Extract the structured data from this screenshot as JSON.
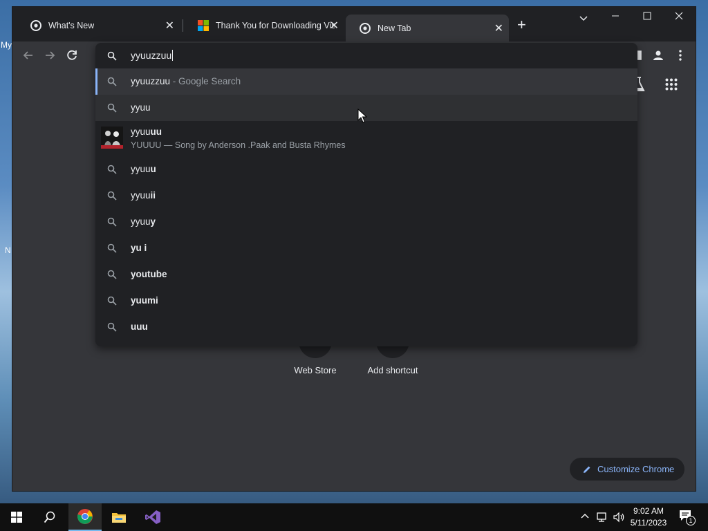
{
  "desktop": {
    "label_my": "My",
    "label_n": "N"
  },
  "tabs": [
    {
      "title": "What's New",
      "favicon": "chrome-icon",
      "active": false
    },
    {
      "title": "Thank You for Downloading Visu",
      "favicon": "microsoft-icon",
      "active": false
    },
    {
      "title": "New Tab",
      "favicon": "chrome-icon",
      "active": true
    }
  ],
  "omnibox": {
    "value": "yyuuzzuu",
    "suggestions": [
      {
        "bold": "yyuuzzuu",
        "suffix": " - Google Search",
        "type": "search",
        "selected": true
      },
      {
        "plain": "yyuu",
        "bold": "",
        "type": "search",
        "hover": true
      },
      {
        "plain": "yyuu",
        "bold": "uu",
        "subtitle": "YUUUU — Song by Anderson .Paak and Busta Rhymes",
        "type": "entity"
      },
      {
        "plain": "yyuu",
        "bold": "u",
        "type": "search"
      },
      {
        "plain": "yyuu",
        "bold": "ii",
        "type": "search"
      },
      {
        "plain": "yyuu",
        "bold": "y",
        "type": "search"
      },
      {
        "plain": "",
        "bold": "yu i",
        "type": "search"
      },
      {
        "plain": "",
        "bold": "youtube",
        "type": "search"
      },
      {
        "plain": "",
        "bold": "yuumi",
        "type": "search"
      },
      {
        "plain": "",
        "bold": "uuu",
        "type": "search"
      }
    ]
  },
  "ntp": {
    "shortcuts": [
      {
        "label": "Web Store"
      },
      {
        "label": "Add shortcut"
      }
    ],
    "customize_label": "Customize Chrome"
  },
  "taskbar": {
    "time": "9:02 AM",
    "date": "5/11/2023",
    "notification_count": "1"
  },
  "colors": {
    "accent": "#8ab4f8",
    "frame": "#202124",
    "surface": "#35363a"
  }
}
